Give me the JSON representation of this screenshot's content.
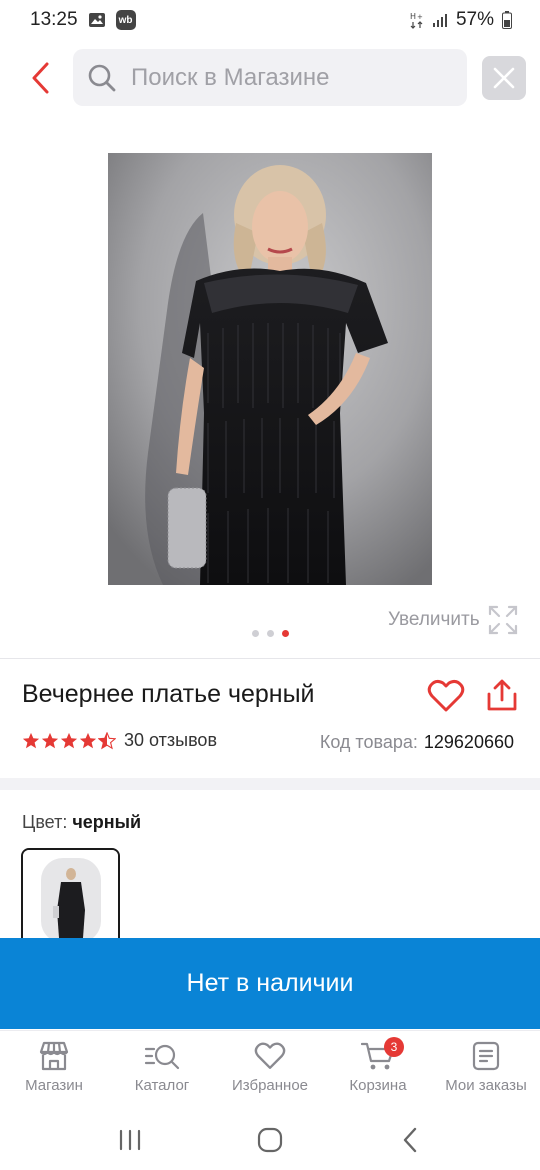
{
  "status_bar": {
    "time": "13:25",
    "battery": "57%"
  },
  "search": {
    "placeholder": "Поиск в Магазине"
  },
  "gallery": {
    "zoom_label": "Увеличить",
    "dots_count": 3,
    "active_dot": 3
  },
  "product": {
    "title": "Вечернее платье черный",
    "rating": 4.5,
    "reviews": "30 отзывов",
    "sku_label": "Код товара:",
    "sku_value": "129620660"
  },
  "color": {
    "label": "Цвет:",
    "value": "черный"
  },
  "action_button": {
    "label": "Нет в наличии"
  },
  "bottom_nav": {
    "items": [
      {
        "label": "Магазин",
        "icon": "store-icon"
      },
      {
        "label": "Каталог",
        "icon": "catalog-search-icon"
      },
      {
        "label": "Избранное",
        "icon": "heart-icon"
      },
      {
        "label": "Корзина",
        "icon": "cart-icon",
        "badge": "3"
      },
      {
        "label": "Мои заказы",
        "icon": "orders-icon"
      }
    ]
  },
  "colors": {
    "accent_red": "#e53935",
    "primary_blue": "#0a84d6"
  }
}
